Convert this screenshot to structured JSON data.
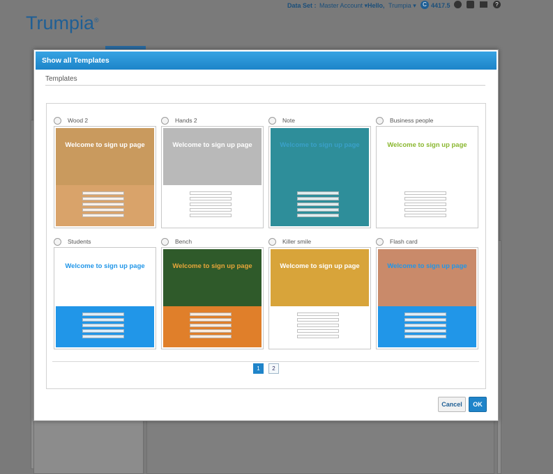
{
  "topbar": {
    "dataset_label": "Data Set :",
    "dataset_value": "Master Account",
    "hello": "Hello,",
    "user": "Trumpia",
    "credits": "4417.5"
  },
  "brand": {
    "logo": "Trumpia",
    "reg": "®"
  },
  "modal": {
    "title": "Show all Templates",
    "section": "Templates",
    "templates": [
      {
        "name": "Wood 2",
        "headline": "Welcome to sign up page",
        "hero": "#c99a5e",
        "body": "#d9a36a",
        "text": "#fff"
      },
      {
        "name": "Hands 2",
        "headline": "Welcome to sign up page",
        "hero": "#b9b9b9",
        "body": "#ffffff",
        "text": "#fff"
      },
      {
        "name": "Note",
        "headline": "Welcome to sign up page",
        "hero": "#2e8e9a",
        "body": "#2e8e9a",
        "text": "#3aa0c8"
      },
      {
        "name": "Business people",
        "headline": "Welcome to sign up page",
        "hero": "#ffffff",
        "body": "#ffffff",
        "text": "#8ab72f"
      },
      {
        "name": "Students",
        "headline": "Welcome to sign up page",
        "hero": "#ffffff",
        "body": "#2196e8",
        "text": "#2196e8"
      },
      {
        "name": "Bench",
        "headline": "Welcome to sign up page",
        "hero": "#2f5a2a",
        "body": "#e07f2a",
        "text": "#e8a63a"
      },
      {
        "name": "Killer smile",
        "headline": "Welcome to sign up page",
        "hero": "#d8a43a",
        "body": "#ffffff",
        "text": "#fff"
      },
      {
        "name": "Flash card",
        "headline": "Welcome to sign up page",
        "hero": "#c98a6a",
        "body": "#2196e8",
        "text": "#2196e8"
      }
    ],
    "pages": [
      "1",
      "2"
    ],
    "cancel": "Cancel",
    "ok": "OK"
  },
  "colors": {
    "accent": "#1f84c9",
    "header": "#2a96d8"
  }
}
